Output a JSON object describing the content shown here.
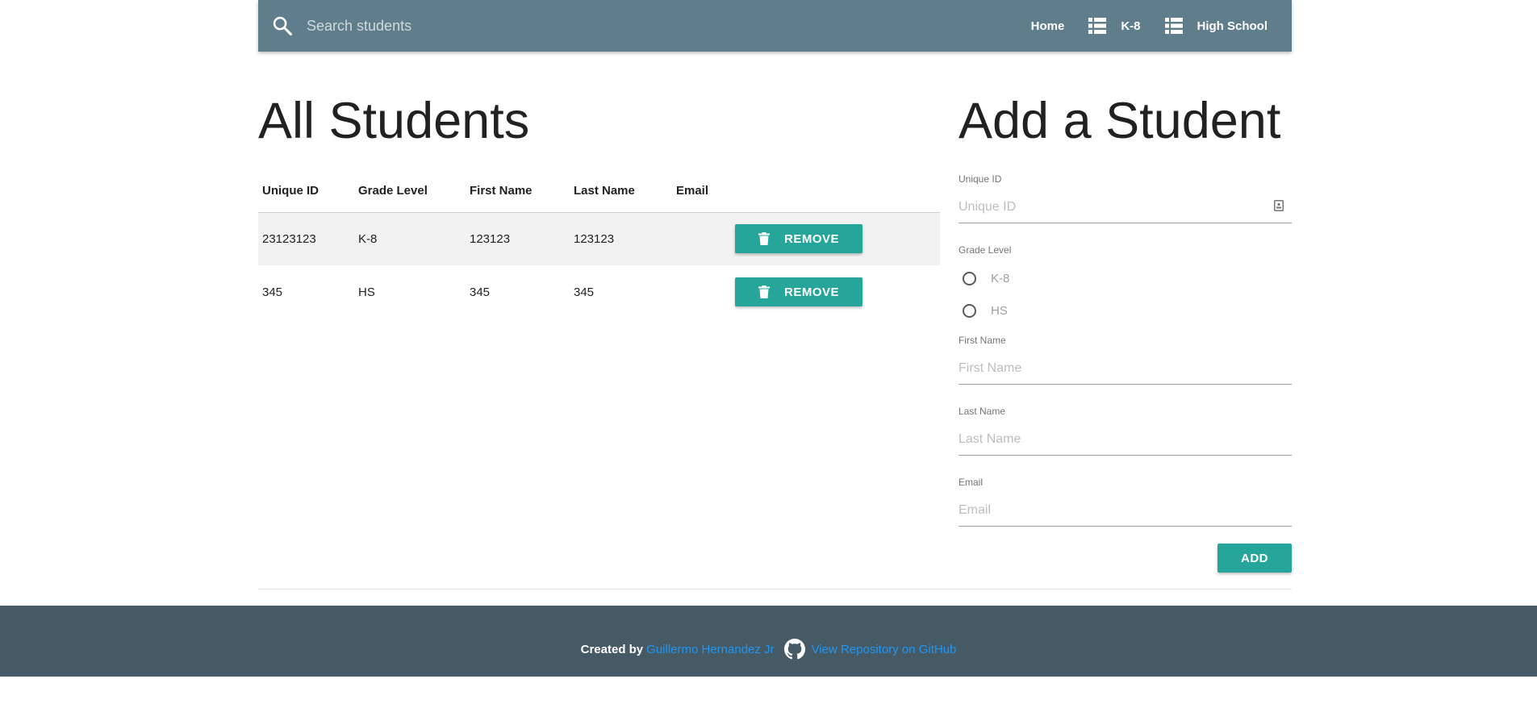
{
  "navbar": {
    "search_placeholder": "Search students",
    "links": [
      {
        "label": "Home",
        "icon": null
      },
      {
        "label": "K-8",
        "icon": "list-icon"
      },
      {
        "label": "High School",
        "icon": "list-icon"
      }
    ]
  },
  "students": {
    "heading": "All Students",
    "columns": [
      "Unique ID",
      "Grade Level",
      "First Name",
      "Last Name",
      "Email"
    ],
    "rows": [
      {
        "id": "23123123",
        "grade": "K-8",
        "first": "123123",
        "last": "123123",
        "email": ""
      },
      {
        "id": "345",
        "grade": "HS",
        "first": "345",
        "last": "345",
        "email": ""
      }
    ],
    "remove_label": "REMOVE"
  },
  "form": {
    "heading": "Add a Student",
    "unique_id": {
      "label": "Unique ID",
      "placeholder": "Unique ID"
    },
    "grade_level": {
      "label": "Grade Level",
      "options": [
        "K-8",
        "HS"
      ]
    },
    "first_name": {
      "label": "First Name",
      "placeholder": "First Name"
    },
    "last_name": {
      "label": "Last Name",
      "placeholder": "Last Name"
    },
    "email": {
      "label": "Email",
      "placeholder": "Email"
    },
    "add_label": "ADD"
  },
  "footer": {
    "created_by": "Created by",
    "author": "Guillermo Hernandez Jr",
    "repo_link": "View Repository on GitHub"
  },
  "colors": {
    "navbar": "#607d8b",
    "footer": "#455a64",
    "accent": "#26a69a",
    "link": "#2196f3"
  }
}
